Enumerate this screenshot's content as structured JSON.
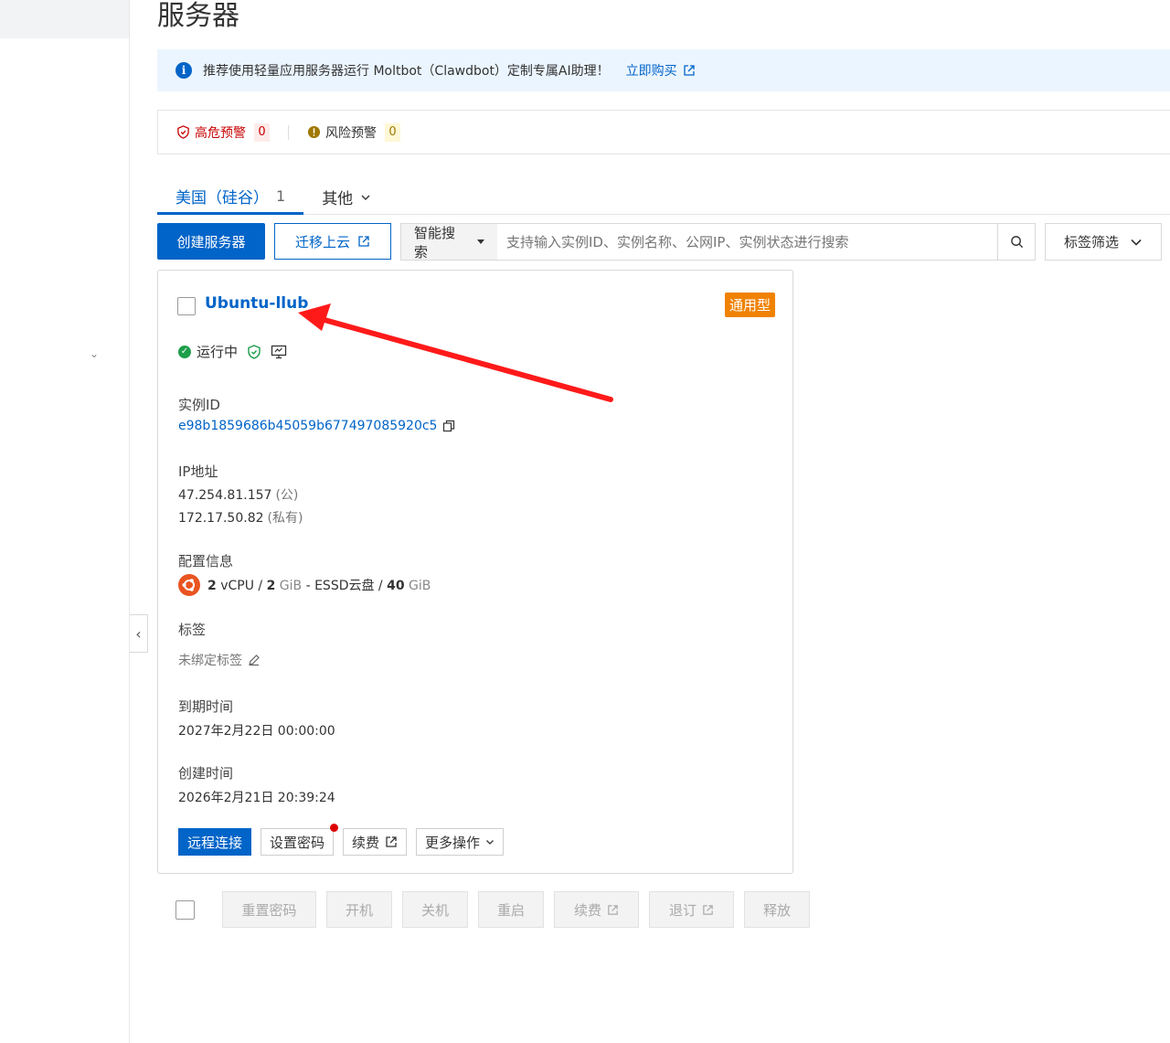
{
  "page": {
    "title": "服务器"
  },
  "notice": {
    "text": "推荐使用轻量应用服务器运行 Moltbot（Clawdbot）定制专属AI助理！",
    "link": "立即购买"
  },
  "alerts": {
    "high_label": "高危预警",
    "high_count": "0",
    "risk_label": "风险预警",
    "risk_count": "0"
  },
  "tabs": [
    {
      "label": "美国（硅谷）",
      "count": "1",
      "active": true
    },
    {
      "label": "其他",
      "count": "",
      "active": false
    }
  ],
  "toolbar": {
    "create_label": "创建服务器",
    "migrate_label": "迁移上云",
    "search_scope": "智能搜索",
    "search_placeholder": "支持输入实例ID、实例名称、公网IP、实例状态进行搜索",
    "tag_filter_label": "标签筛选"
  },
  "instance": {
    "name": "Ubuntu-llub",
    "type_badge": "通用型",
    "status": "运行中",
    "id_label": "实例ID",
    "id_value": "e98b1859686b45059b677497085920c5",
    "ip_label": "IP地址",
    "public_ip": "47.254.81.157",
    "public_suffix": "(公)",
    "private_ip": "172.17.50.82",
    "private_suffix": "(私有)",
    "config_label": "配置信息",
    "cpu_num": "2",
    "cpu_unit": "vCPU /",
    "mem_num": "2",
    "mem_unit": "GiB",
    "disk_text": "- ESSD云盘 /",
    "disk_num": "40",
    "disk_unit": "GiB",
    "tags_label": "标签",
    "tags_value": "未绑定标签",
    "expire_label": "到期时间",
    "expire_value": "2027年2月22日 00:00:00",
    "created_label": "创建时间",
    "created_value": "2026年2月21日 20:39:24",
    "actions": {
      "remote": "远程连接",
      "set_password": "设置密码",
      "renew": "续费",
      "more": "更多操作"
    }
  },
  "batch_actions": [
    "重置密码",
    "开机",
    "关机",
    "重启",
    "续费",
    "退订",
    "释放"
  ],
  "colors": {
    "primary": "#0064c8",
    "danger": "#c80000",
    "badge": "#f08200",
    "running": "#1e9e4a",
    "annotation_arrow": "#ff1a1a"
  }
}
